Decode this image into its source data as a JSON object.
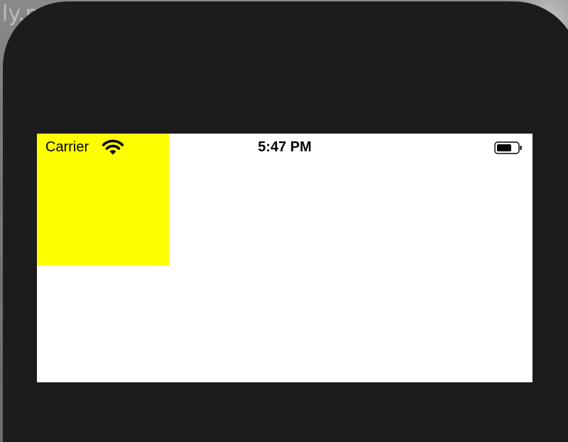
{
  "backdrop": {
    "partial_text": "ily.n"
  },
  "status_bar": {
    "carrier": "Carrier",
    "time": "5:47 PM",
    "wifi_icon": "wifi-icon",
    "battery_icon": "battery-icon"
  },
  "colors": {
    "frame": "#1c1c1c",
    "screen": "#ffffff",
    "yellow_view": "#ffff00"
  }
}
